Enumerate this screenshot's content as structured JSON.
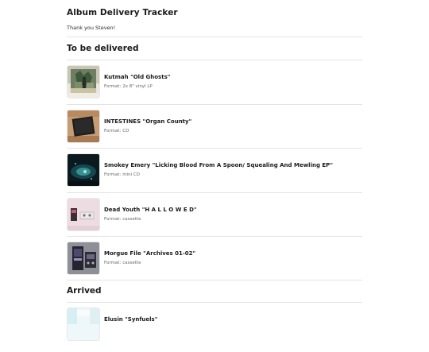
{
  "header": {
    "title": "Album Delivery Tracker",
    "thanks": "Thank you Steven!"
  },
  "sections": {
    "to_be_delivered": {
      "title": "To be delivered",
      "items": [
        {
          "title": "Kutmah \"Old Ghosts\"",
          "format_label": "Format:",
          "format": "2x 8\" vinyl LP",
          "cover_icon": "vinyl-cover-photo"
        },
        {
          "title": "INTESTINES \"Organ County\"",
          "format_label": "Format:",
          "format": "CD",
          "cover_icon": "cd-cover-photo"
        },
        {
          "title": "Smokey Emery \"Licking Blood From A Spoon/ Squealing And Mewling EP\"",
          "format_label": "Format:",
          "format": "mini CD",
          "cover_icon": "mini-cd-cover-photo"
        },
        {
          "title": "Dead Youth \"H A L L O W E D\"",
          "format_label": "Format:",
          "format": "cassette",
          "cover_icon": "cassette-cover-photo"
        },
        {
          "title": "Morgue File \"Archives 01-02\"",
          "format_label": "Format:",
          "format": "cassette",
          "cover_icon": "cassette-cover-photo"
        }
      ]
    },
    "arrived": {
      "title": "Arrived",
      "items": [
        {
          "title": "Elusin \"Synfuels\"",
          "cover_icon": "album-cover-photo"
        }
      ]
    }
  }
}
